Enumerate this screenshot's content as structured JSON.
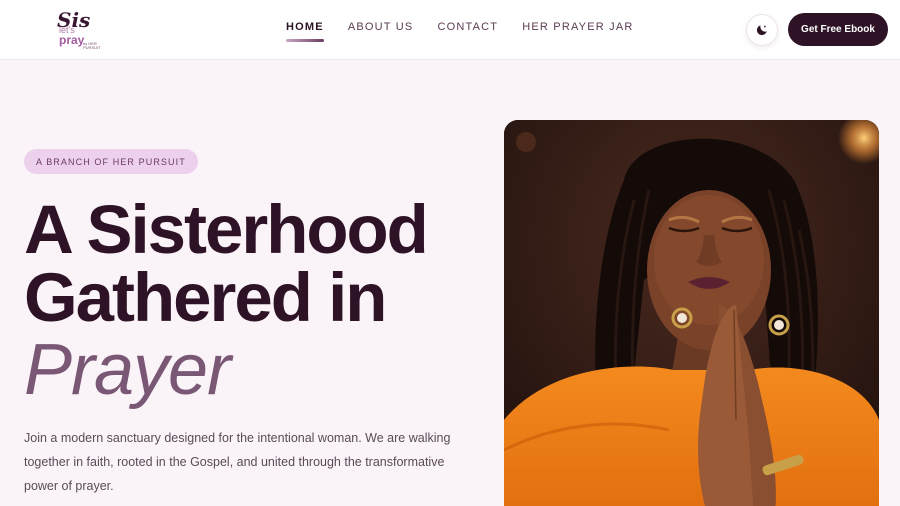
{
  "brand": {
    "logo_line1": "Sis",
    "logo_line2": "let's",
    "logo_line3": "pray",
    "logo_line4": "by HER PURSUIT"
  },
  "nav": {
    "items": [
      {
        "label": "HOME",
        "active": true
      },
      {
        "label": "ABOUT US",
        "active": false
      },
      {
        "label": "CONTACT",
        "active": false
      },
      {
        "label": "HER PRAYER JAR",
        "active": false
      }
    ]
  },
  "header_actions": {
    "theme_toggle_icon": "moon-icon",
    "cta_label": "Get Free Ebook"
  },
  "hero": {
    "badge": "A BRANCH OF HER PURSUIT",
    "headline_line1": "A Sisterhood",
    "headline_line2": "Gathered in",
    "headline_line3": "Prayer",
    "description": "Join a modern sanctuary designed for the intentional woman. We are walking together in faith, rooted in the Gospel, and united through the transformative power of prayer."
  },
  "colors": {
    "brand_dark": "#2e1326",
    "badge_bg": "#ecd0ec",
    "accent_mauve": "#7a5875",
    "page_bg": "#faf4f9"
  }
}
